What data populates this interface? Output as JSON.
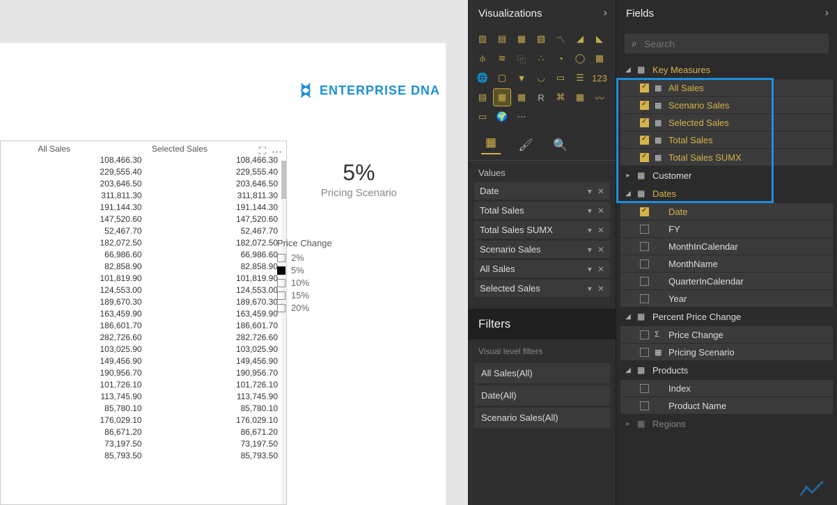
{
  "canvas": {
    "logo_brand": "ENTERPRISE",
    "logo_accent": "DNA",
    "card": {
      "value": "5%",
      "label": "Pricing Scenario"
    },
    "slicer": {
      "title": "Price Change",
      "options": [
        {
          "label": "2%",
          "selected": false
        },
        {
          "label": "5%",
          "selected": true
        },
        {
          "label": "10%",
          "selected": false
        },
        {
          "label": "15%",
          "selected": false
        },
        {
          "label": "20%",
          "selected": false
        }
      ]
    },
    "table": {
      "col1": "All Sales",
      "col2": "Selected Sales",
      "rows": [
        [
          "108,466.30",
          "108,466.30"
        ],
        [
          "229,555.40",
          "229,555.40"
        ],
        [
          "203,646.50",
          "203,646.50"
        ],
        [
          "311,811.30",
          "311,811.30"
        ],
        [
          "191,144.30",
          "191,144.30"
        ],
        [
          "147,520.60",
          "147,520.60"
        ],
        [
          "52,467.70",
          "52,467.70"
        ],
        [
          "182,072.50",
          "182,072.50"
        ],
        [
          "66,986.60",
          "66,986.60"
        ],
        [
          "82,858.90",
          "82,858.90"
        ],
        [
          "101,819.90",
          "101,819.90"
        ],
        [
          "124,553.00",
          "124,553.00"
        ],
        [
          "189,670.30",
          "189,670.30"
        ],
        [
          "163,459.90",
          "163,459.90"
        ],
        [
          "186,601.70",
          "186,601.70"
        ],
        [
          "282,726.60",
          "282,726.60"
        ],
        [
          "103,025.90",
          "103,025.90"
        ],
        [
          "149,456.90",
          "149,456.90"
        ],
        [
          "190,956.70",
          "190,956.70"
        ],
        [
          "101,726.10",
          "101,726.10"
        ],
        [
          "113,745.90",
          "113,745.90"
        ],
        [
          "85,780.10",
          "85,780.10"
        ],
        [
          "176,029.10",
          "176,029.10"
        ],
        [
          "86,671.20",
          "86,671.20"
        ],
        [
          "73,197.50",
          "73,197.50"
        ],
        [
          "85,793.50",
          "85,793.50"
        ]
      ]
    }
  },
  "viz": {
    "title": "Visualizations",
    "values_label": "Values",
    "wells": [
      "Date",
      "Total Sales",
      "Total Sales SUMX",
      "Scenario Sales",
      "All Sales",
      "Selected Sales"
    ],
    "filters_title": "Filters",
    "visual_filters_label": "Visual level filters",
    "filter_items": [
      "All Sales(All)",
      "Date(All)",
      "Scenario Sales(All)"
    ]
  },
  "fields": {
    "title": "Fields",
    "search_placeholder": "Search",
    "key_measures": {
      "name": "Key Measures",
      "items": [
        "All Sales",
        "Scenario Sales",
        "Selected Sales",
        "Total Sales",
        "Total Sales SUMX"
      ]
    },
    "customer": "Customer",
    "dates": {
      "name": "Dates",
      "items": [
        {
          "name": "Date",
          "checked": true
        },
        {
          "name": "FY",
          "checked": false
        },
        {
          "name": "MonthInCalendar",
          "checked": false
        },
        {
          "name": "MonthName",
          "checked": false
        },
        {
          "name": "QuarterInCalendar",
          "checked": false
        },
        {
          "name": "Year",
          "checked": false
        }
      ]
    },
    "ppc": {
      "name": "Percent Price Change",
      "items": [
        {
          "name": "Price Change",
          "icon": "Σ"
        },
        {
          "name": "Pricing Scenario",
          "icon": "▦"
        }
      ]
    },
    "products": {
      "name": "Products",
      "items": [
        "Index",
        "Product Name"
      ]
    },
    "regions": "Regions"
  }
}
